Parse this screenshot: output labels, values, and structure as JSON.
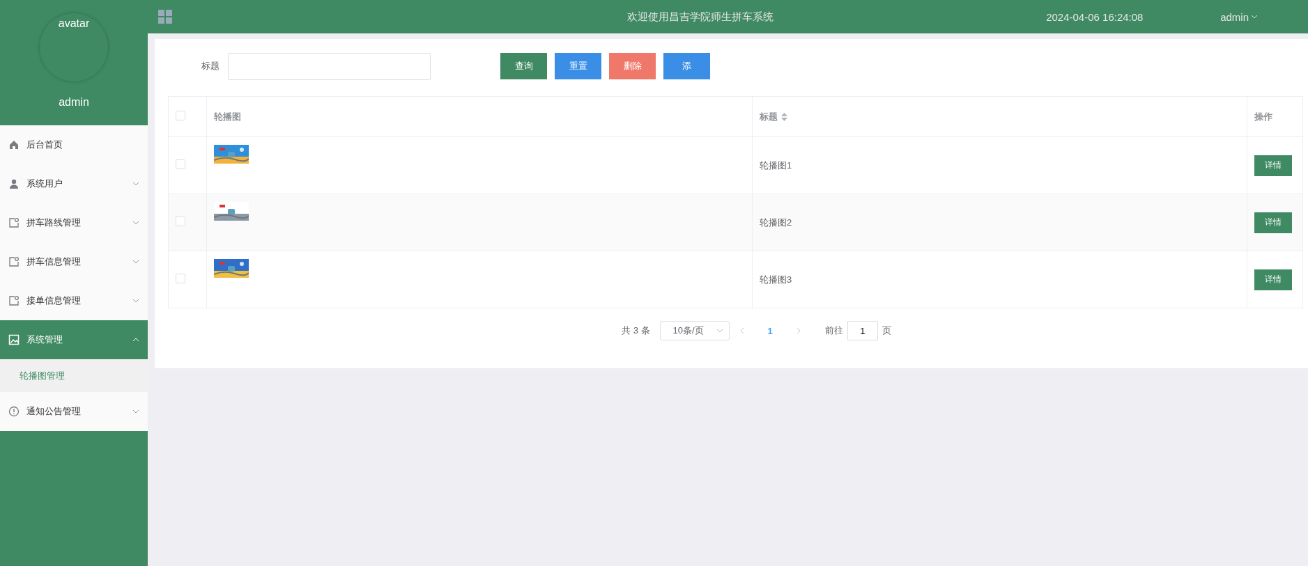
{
  "header": {
    "title": "欢迎使用昌吉学院师生拼车系统",
    "datetime": "2024-04-06 16:24:08",
    "user": "admin"
  },
  "profile": {
    "avatar_alt": "avatar",
    "name": "admin"
  },
  "menu": [
    {
      "label": "后台首页",
      "kind": "link",
      "expanded": false
    },
    {
      "label": "系统用户",
      "kind": "submenu",
      "expanded": false
    },
    {
      "label": "拼车路线管理",
      "kind": "submenu",
      "expanded": false
    },
    {
      "label": "拼车信息管理",
      "kind": "submenu",
      "expanded": false
    },
    {
      "label": "接单信息管理",
      "kind": "submenu",
      "expanded": false
    },
    {
      "label": "系统管理",
      "kind": "submenu",
      "expanded": true,
      "children": [
        {
          "label": "轮播图管理",
          "selected": true
        }
      ]
    },
    {
      "label": "通知公告管理",
      "kind": "submenu",
      "expanded": false
    }
  ],
  "search": {
    "label": "标题"
  },
  "buttons": [
    {
      "label": "查询",
      "kind": "primary"
    },
    {
      "label": "重置",
      "kind": "info"
    },
    {
      "label": "删除",
      "kind": "danger"
    },
    {
      "label": "添",
      "kind": "info"
    }
  ],
  "table": {
    "all_checked": false,
    "columns": [
      {
        "label": "轮播图",
        "sortable": false
      },
      {
        "label": "标题",
        "sortable": true
      },
      {
        "label": "操作",
        "sortable": false
      }
    ],
    "rows": [
      {
        "checked": false,
        "title": "轮播图1",
        "action": "详情"
      },
      {
        "checked": false,
        "title": "轮播图2",
        "action": "详情"
      },
      {
        "checked": false,
        "title": "轮播图3",
        "action": "详情"
      }
    ]
  },
  "pagination": {
    "total": "共 3 条",
    "page_size": "10条/页",
    "pages": [
      {
        "label": "1",
        "selected": true
      }
    ],
    "goto_label": "前往",
    "goto_value": "1",
    "goto_suffix": "页"
  }
}
